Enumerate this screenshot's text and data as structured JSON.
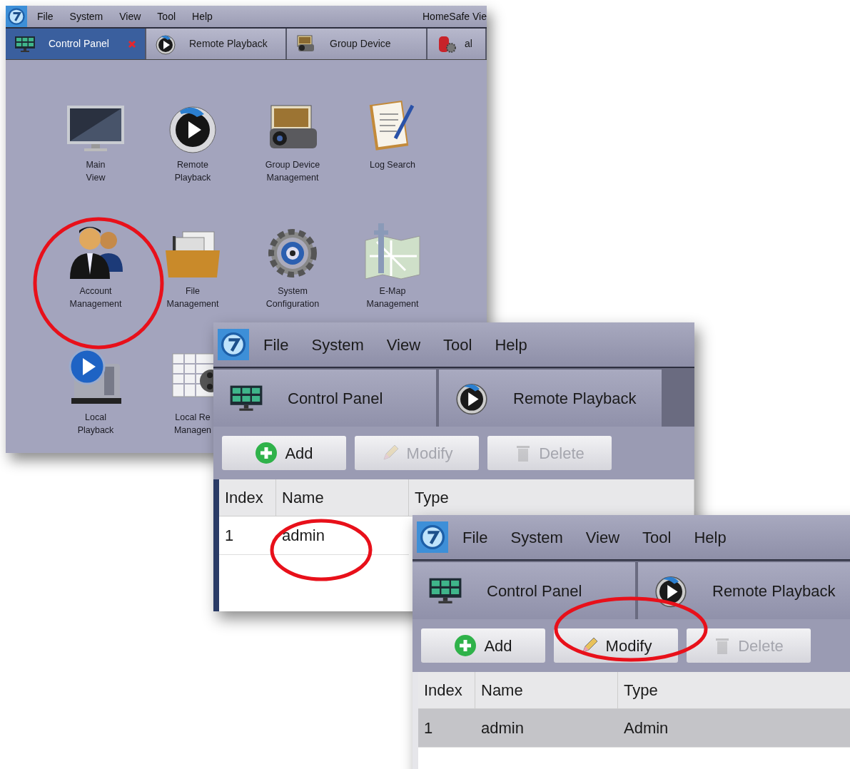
{
  "main_window": {
    "menu": [
      "File",
      "System",
      "View",
      "Tool",
      "Help"
    ],
    "app_title": "HomeSafe Vie",
    "tabs": [
      {
        "label": "Control Panel",
        "selected": true,
        "closable": true
      },
      {
        "label": "Remote Playback",
        "selected": false,
        "closable": false
      },
      {
        "label": "Group Device",
        "selected": false,
        "closable": false
      },
      {
        "label": "al",
        "selected": false,
        "closable": false
      }
    ],
    "tiles": [
      {
        "lines": [
          "Main",
          "View"
        ]
      },
      {
        "lines": [
          "Remote",
          "Playback"
        ]
      },
      {
        "lines": [
          "Group Device",
          "Management"
        ]
      },
      {
        "lines": [
          "Log Search"
        ]
      },
      {
        "lines": [
          "Account",
          "Management"
        ]
      },
      {
        "lines": [
          "File",
          "Management"
        ]
      },
      {
        "lines": [
          "System",
          "Configuration"
        ]
      },
      {
        "lines": [
          "E-Map",
          "Management"
        ]
      },
      {
        "lines": [
          "Local",
          "Playback"
        ]
      },
      {
        "lines": [
          "Local Re",
          "Managen"
        ]
      }
    ]
  },
  "account_windows": [
    {
      "menu": [
        "File",
        "System",
        "View",
        "Tool",
        "Help"
      ],
      "tabs": [
        {
          "label": "Control Panel",
          "selected": false
        },
        {
          "label": "Remote Playback",
          "selected": false
        }
      ],
      "buttons": [
        {
          "label": "Add",
          "disabled": false
        },
        {
          "label": "Modify",
          "disabled": true
        },
        {
          "label": "Delete",
          "disabled": true
        }
      ],
      "columns": [
        "Index",
        "Name",
        "Type"
      ],
      "rows": [
        {
          "cells": [
            "1",
            "admin"
          ],
          "selected": false
        }
      ]
    },
    {
      "menu": [
        "File",
        "System",
        "View",
        "Tool",
        "Help"
      ],
      "tabs": [
        {
          "label": "Control Panel",
          "selected": false
        },
        {
          "label": "Remote Playback",
          "selected": false
        }
      ],
      "buttons": [
        {
          "label": "Add",
          "disabled": false
        },
        {
          "label": "Modify",
          "disabled": false
        },
        {
          "label": "Delete",
          "disabled": true
        }
      ],
      "columns": [
        "Index",
        "Name",
        "Type"
      ],
      "rows": [
        {
          "cells": [
            "1",
            "admin",
            "Admin"
          ],
          "selected": true
        }
      ]
    }
  ]
}
